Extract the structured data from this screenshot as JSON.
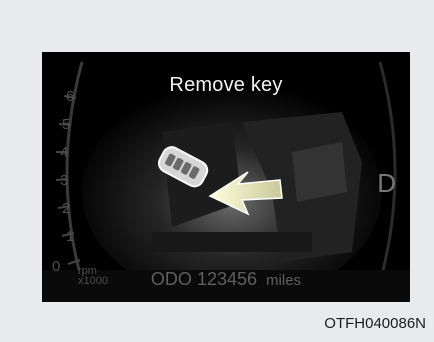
{
  "display": {
    "title": "Remove key",
    "odometer_prefix": "ODO",
    "odometer_value": "123456",
    "odometer_unit": "miles",
    "gear": "D",
    "rpm_label": "rpm",
    "rpm_multiplier": "x1000",
    "tach_ticks": [
      "6",
      "5",
      "4",
      "3",
      "2",
      "1",
      "0"
    ]
  },
  "figure": {
    "caption": "OTFH040086N"
  },
  "icons": {
    "key_fob": "smart-key-icon",
    "arrow": "arrow-icon",
    "ignition": "ignition-slot-icon"
  },
  "colors": {
    "background": "#e9eaec",
    "screen": "#000000",
    "arrow": "#e8e8b0",
    "title_text": "#f2f2f2"
  }
}
